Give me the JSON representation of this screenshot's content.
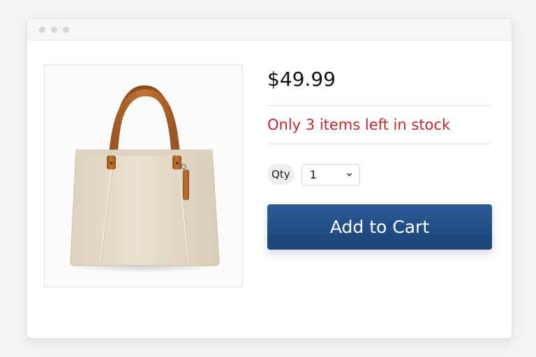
{
  "product": {
    "image_alt": "canvas-tote-bag",
    "price": "$49.99",
    "stock_message": "Only 3 items left in stock"
  },
  "quantity": {
    "label": "Qty",
    "selected": "1",
    "icon": "chevron-down-icon"
  },
  "cart": {
    "add_label": "Add to Cart"
  },
  "colors": {
    "stock_warning": "#c8262b",
    "button": "#234d86",
    "bag_canvas": "#e6dccb",
    "bag_leather": "#b86a2e"
  }
}
